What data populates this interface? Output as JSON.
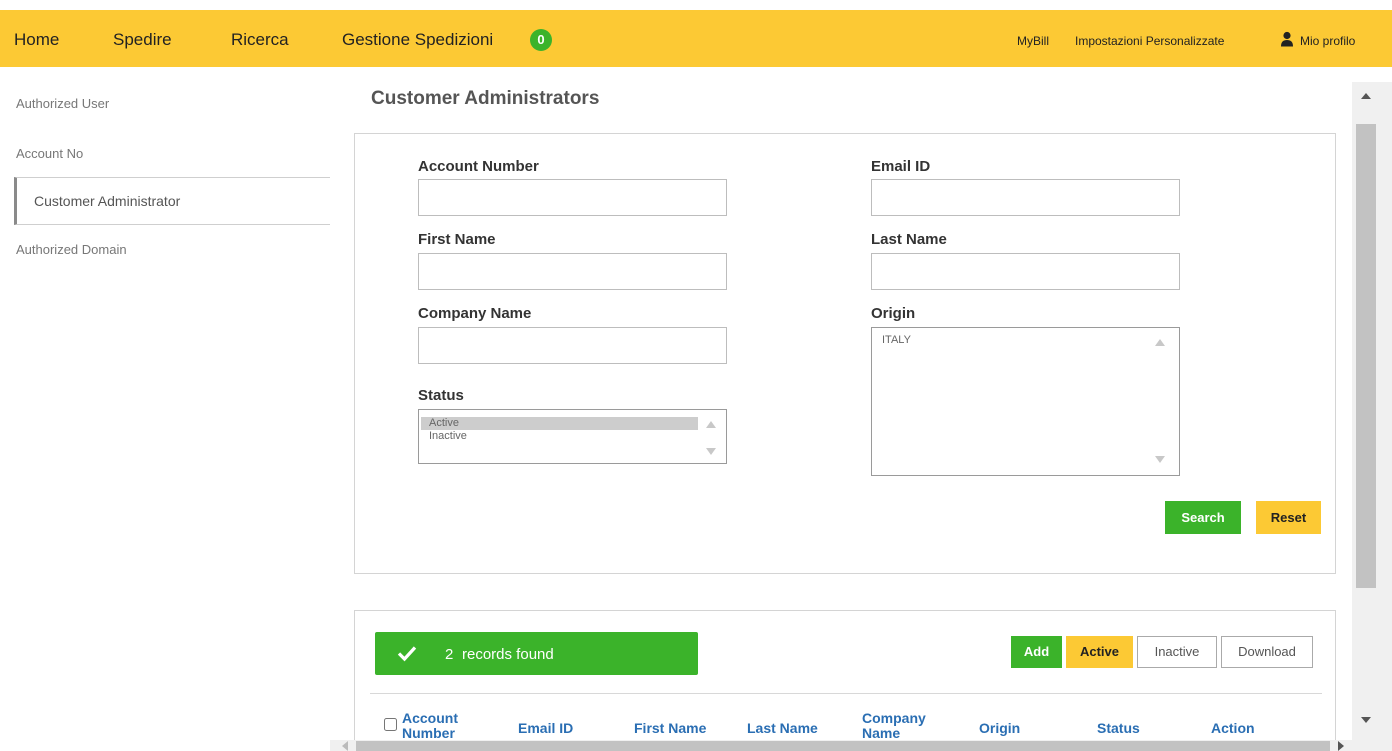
{
  "nav": {
    "home": "Home",
    "spedire": "Spedire",
    "ricerca": "Ricerca",
    "gestione": "Gestione Spedizioni",
    "gestione_badge": "0",
    "mybill": "MyBill",
    "impostazioni": "Impostazioni Personalizzate",
    "profilo": "Mio profilo"
  },
  "sidebar": {
    "items": [
      {
        "label": "Authorized User"
      },
      {
        "label": "Account No"
      },
      {
        "label": "Customer Administrator"
      },
      {
        "label": "Authorized Domain"
      }
    ],
    "active_index": 2
  },
  "page_title": "Customer Administrators",
  "form": {
    "account_number_label": "Account Number",
    "account_number_value": "",
    "email_label": "Email ID",
    "email_value": "",
    "first_name_label": "First Name",
    "first_name_value": "",
    "last_name_label": "Last Name",
    "last_name_value": "",
    "company_name_label": "Company Name",
    "company_name_value": "",
    "origin_label": "Origin",
    "origin_options": [
      "ITALY"
    ],
    "status_label": "Status",
    "status_options": [
      "Active",
      "Inactive"
    ],
    "status_selected": "Active",
    "search_button": "Search",
    "reset_button": "Reset"
  },
  "results": {
    "count": "2",
    "count_label": "records found",
    "add_button": "Add",
    "active_button": "Active",
    "inactive_button": "Inactive",
    "download_button": "Download",
    "columns": [
      "Account Number",
      "Email ID",
      "First Name",
      "Last Name",
      "Company Name",
      "Origin",
      "Status",
      "Action"
    ]
  },
  "colors": {
    "brand_yellow": "#fcc934",
    "success_green": "#3bb32a",
    "link_blue": "#2a6eb3"
  }
}
